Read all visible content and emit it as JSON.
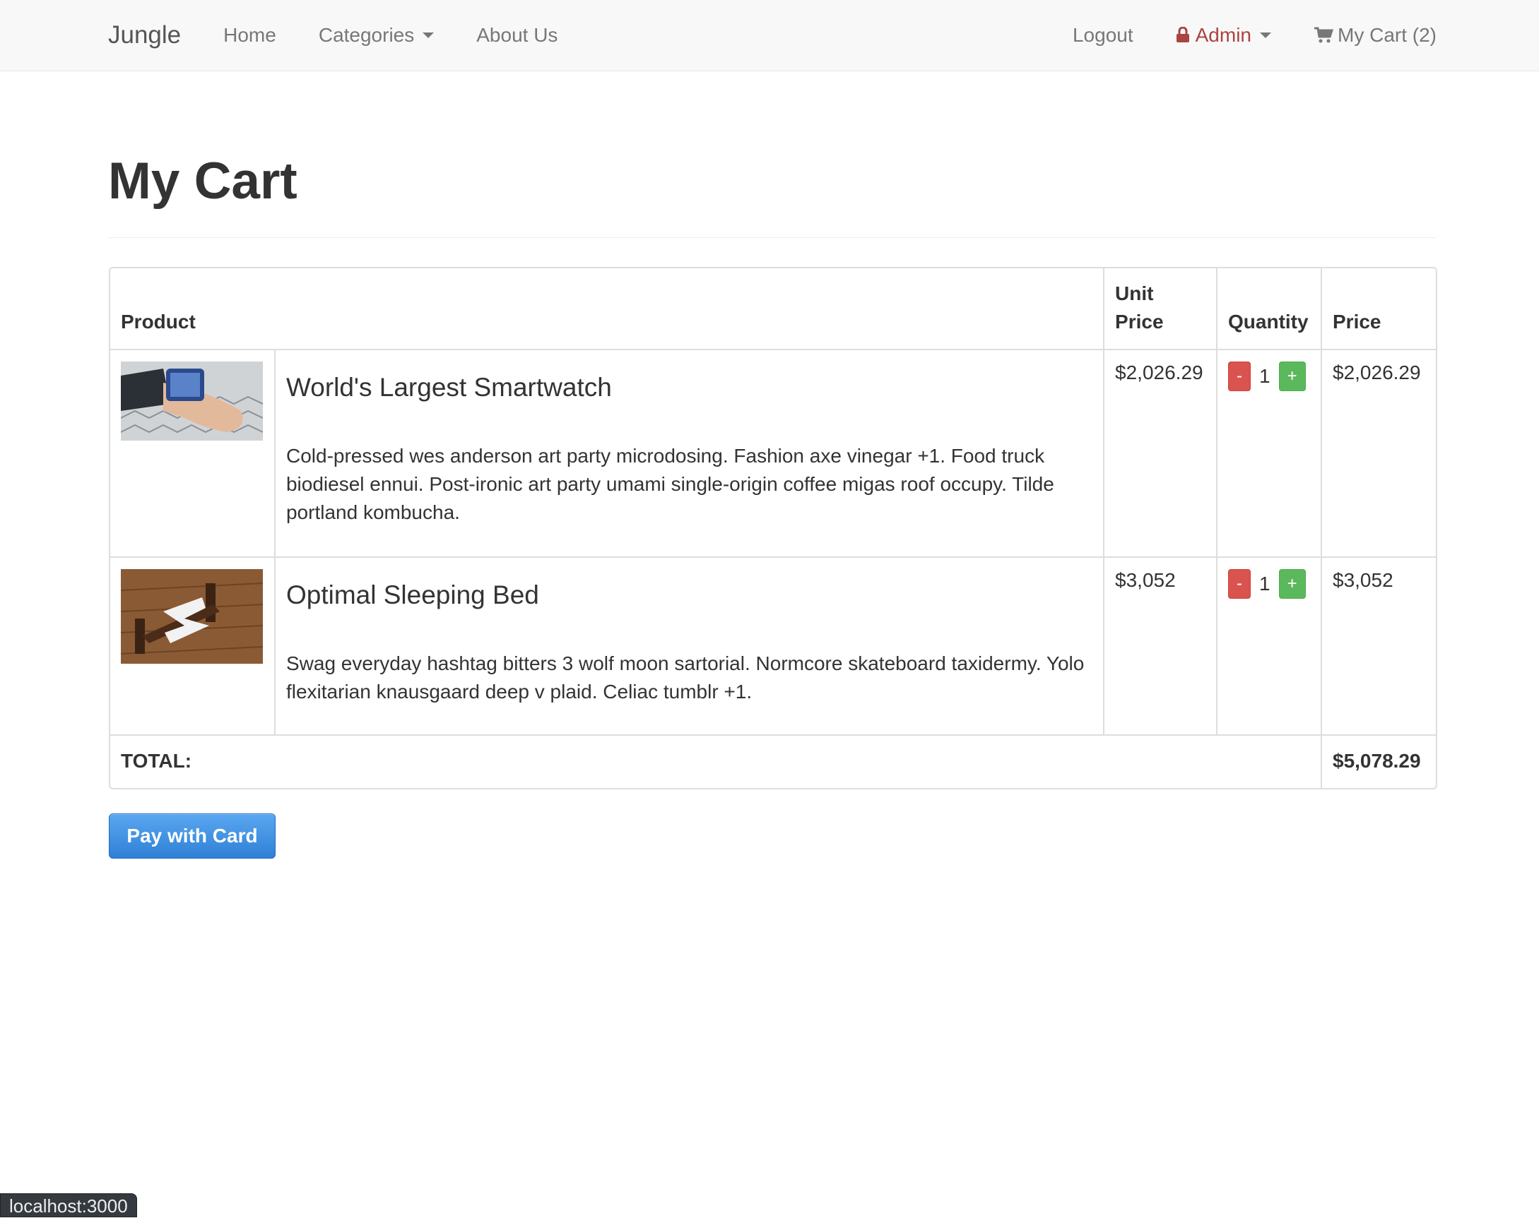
{
  "navbar": {
    "brand": "Jungle",
    "home": "Home",
    "categories": "Categories",
    "about": "About Us",
    "logout": "Logout",
    "admin": "Admin",
    "cart": "My Cart (2)",
    "admin_color": "#a94442"
  },
  "page": {
    "title": "My Cart"
  },
  "table": {
    "headers": {
      "product": "Product",
      "unit_price": "Unit Price",
      "quantity": "Quantity",
      "price": "Price"
    },
    "rows": [
      {
        "name": "World's Largest Smartwatch",
        "description": "Cold-pressed wes anderson art party microdosing. Fashion axe vinegar +1. Food truck biodiesel ennui. Post-ironic art party umami single-origin coffee migas roof occupy. Tilde portland kombucha.",
        "unit_price": "$2,026.29",
        "quantity": "1",
        "price": "$2,026.29",
        "minus_label": "-",
        "plus_label": "+"
      },
      {
        "name": "Optimal Sleeping Bed",
        "description": "Swag everyday hashtag bitters 3 wolf moon sartorial. Normcore skateboard taxidermy. Yolo flexitarian knausgaard deep v plaid. Celiac tumblr +1.",
        "unit_price": "$3,052",
        "quantity": "1",
        "price": "$3,052",
        "minus_label": "-",
        "plus_label": "+"
      }
    ],
    "total_label": "TOTAL:",
    "total_value": "$5,078.29"
  },
  "pay_button": "Pay with Card",
  "status_bar": "localhost:3000"
}
